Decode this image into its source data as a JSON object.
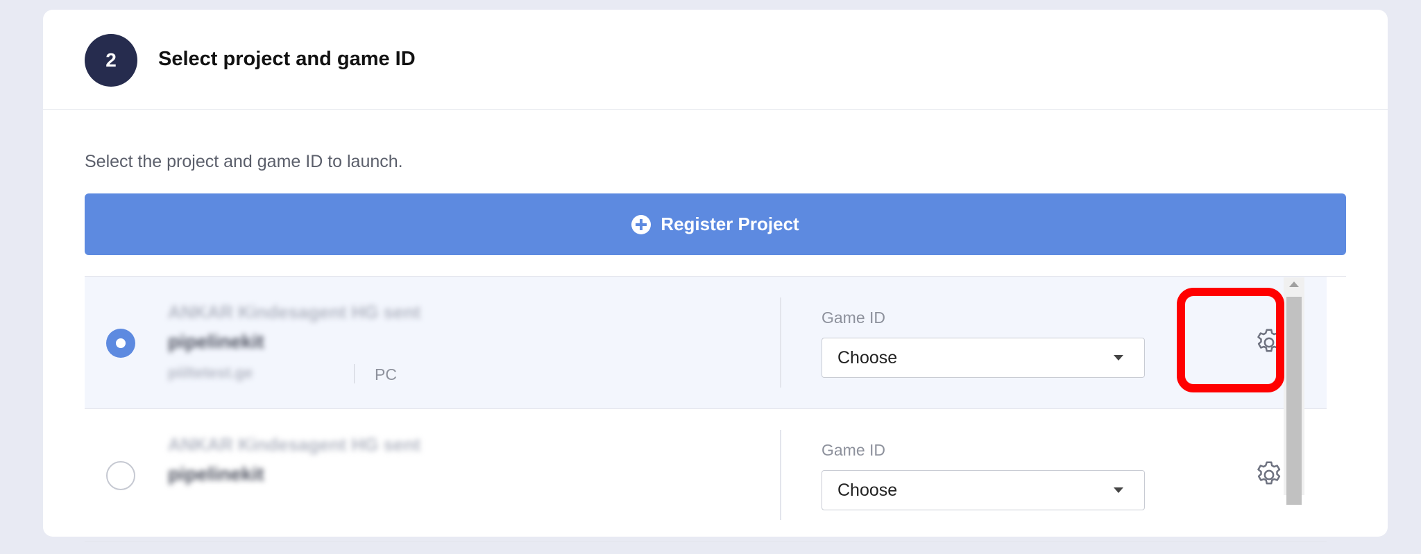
{
  "step": {
    "number": "2",
    "title": "Select project and game ID"
  },
  "intro_text": "Select the project and game ID to launch.",
  "register_button": {
    "label": "Register Project",
    "icon": "plus-circle-icon"
  },
  "projects": [
    {
      "selected": true,
      "name_blurred": "ANKAR Kindesagent HG sent",
      "subtitle_blurred": "pipelinekit",
      "meta_blurred": "piiltetest.ge",
      "platform": "PC",
      "game_id_label": "Game ID",
      "game_id_value": "Choose",
      "settings_icon": "gear-icon"
    },
    {
      "selected": false,
      "name_blurred": "ANKAR Kindesagent HG sent",
      "subtitle_blurred": "pipelinekit",
      "game_id_label": "Game ID",
      "game_id_value": "Choose",
      "settings_icon": "gear-icon"
    }
  ],
  "colors": {
    "page_background": "#e8eaf3",
    "badge": "#262c4e",
    "accent": "#5d8ae0",
    "selected_row": "#f3f6fd",
    "highlight": "#ff0000"
  }
}
